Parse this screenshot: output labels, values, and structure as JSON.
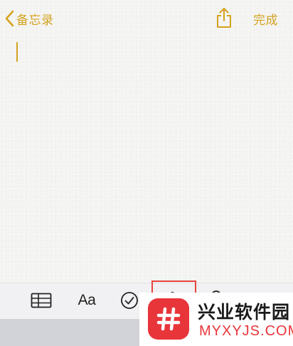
{
  "nav": {
    "back_label": "备忘录",
    "done_label": "完成"
  },
  "toolbar": {
    "format_label": "Aa",
    "items": [
      "table-icon",
      "format-icon",
      "checklist-icon",
      "camera-icon",
      "markup-icon"
    ]
  },
  "watermark": {
    "title": "兴业软件园",
    "subtitle": "MYXYJS.COM"
  },
  "colors": {
    "accent": "#d4a21f",
    "paper": "#f4f4f3",
    "toolbar": "#f1f1f3",
    "highlight_box": "#e8453c",
    "watermark_red": "#e8353a"
  }
}
